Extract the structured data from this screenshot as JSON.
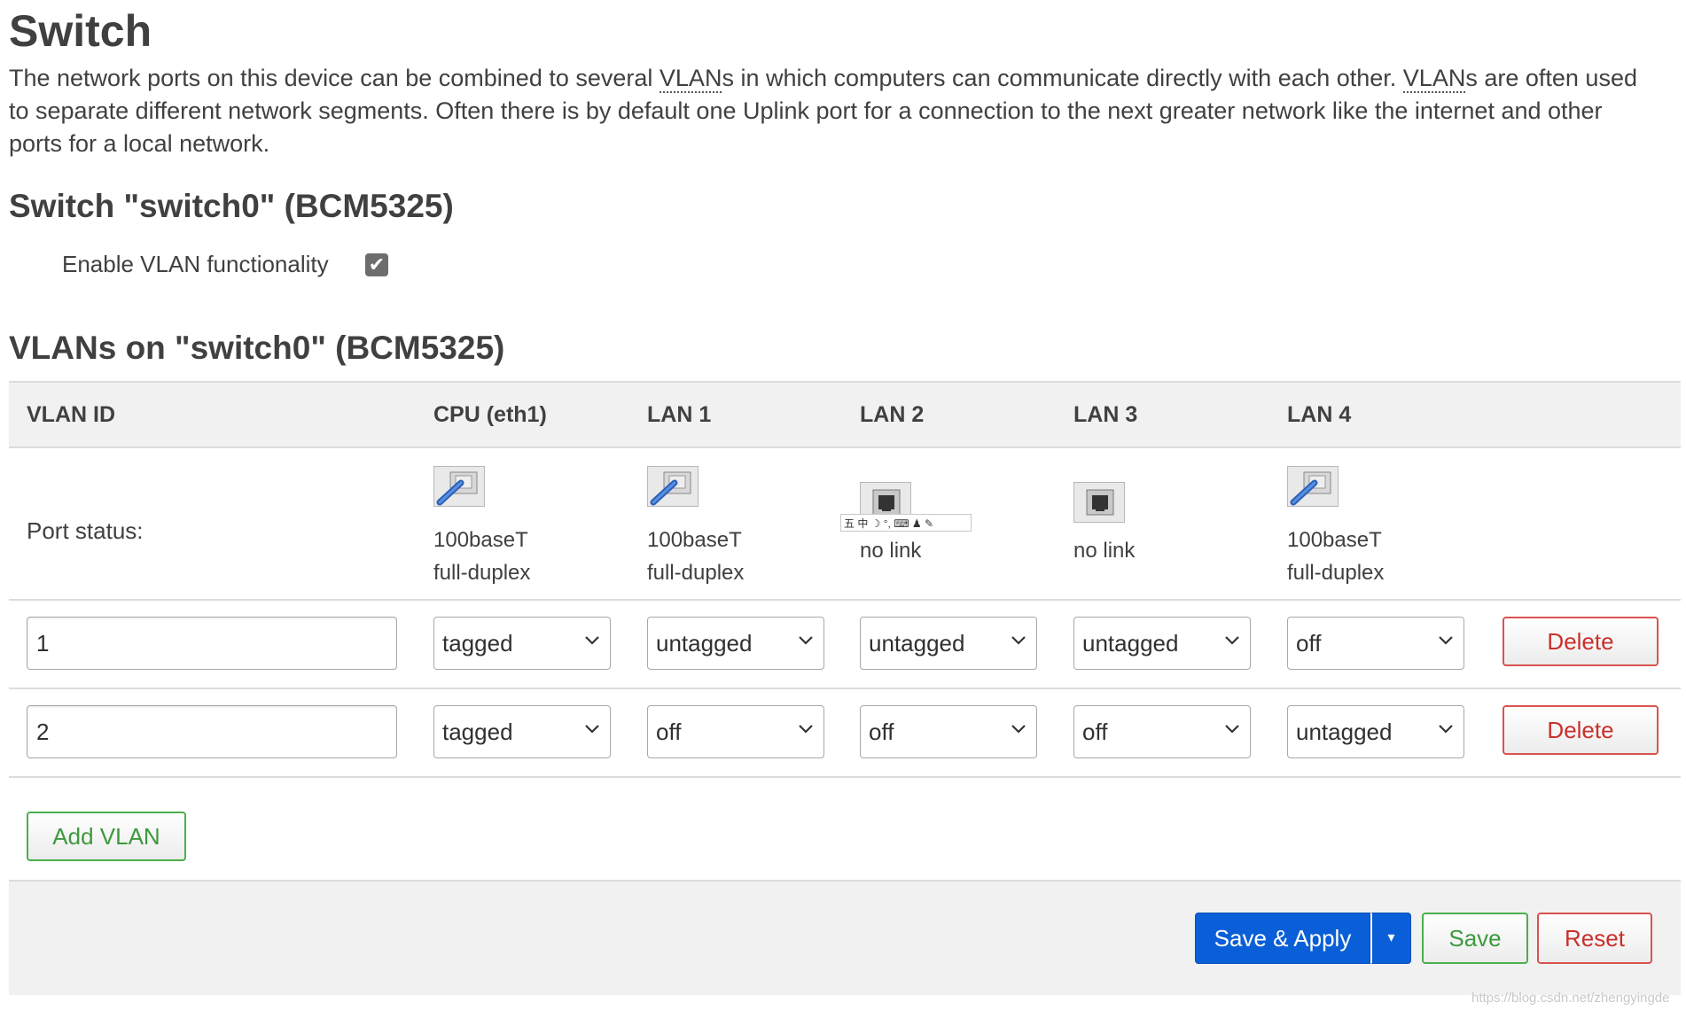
{
  "page": {
    "title": "Switch",
    "description": {
      "p1": "The network ports on this device can be combined to several ",
      "abbr1": "VLAN",
      "p2": "s in which computers can communicate directly with each other. ",
      "abbr2": "VLAN",
      "p3": "s are often used to separate different network segments. Often there is by default one Uplink port for a connection to the next greater network like the internet and other ports for a local network."
    }
  },
  "switch_section": {
    "title": "Switch \"switch0\" (BCM5325)",
    "enable_vlan_label": "Enable VLAN functionality",
    "enable_vlan_checked": true,
    "checkmark": "✔"
  },
  "vlans_section": {
    "title": "VLANs on \"switch0\" (BCM5325)",
    "headers": [
      "VLAN ID",
      "CPU (eth1)",
      "LAN 1",
      "LAN 2",
      "LAN 3",
      "LAN 4"
    ],
    "port_status_label": "Port status:",
    "ports": [
      {
        "name": "CPU (eth1)",
        "icon": "port-connected-icon",
        "speed": "100baseT",
        "duplex": "full-duplex"
      },
      {
        "name": "LAN 1",
        "icon": "port-connected-icon",
        "speed": "100baseT",
        "duplex": "full-duplex"
      },
      {
        "name": "LAN 2",
        "icon": "port-disconnected-icon",
        "status": "no link"
      },
      {
        "name": "LAN 3",
        "icon": "port-disconnected-icon",
        "status": "no link"
      },
      {
        "name": "LAN 4",
        "icon": "port-connected-icon",
        "speed": "100baseT",
        "duplex": "full-duplex"
      }
    ],
    "ime_toolbar": "五 中 ☽ °, ⌨ ♟ ✎",
    "rows": [
      {
        "vlan_id": "1",
        "cpu": "tagged",
        "lan1": "untagged",
        "lan2": "untagged",
        "lan3": "untagged",
        "lan4": "off"
      },
      {
        "vlan_id": "2",
        "cpu": "tagged",
        "lan1": "off",
        "lan2": "off",
        "lan3": "off",
        "lan4": "untagged"
      }
    ],
    "delete_label": "Delete",
    "add_vlan_label": "Add VLAN"
  },
  "footer": {
    "save_apply_label": "Save & Apply",
    "dropdown_glyph": "▾",
    "save_label": "Save",
    "reset_label": "Reset"
  },
  "watermark": "https://blog.csdn.net/zhengyingde",
  "colors": {
    "primary": "#0a5fd8",
    "positive": "#4cae4c",
    "negative": "#d9534f"
  }
}
